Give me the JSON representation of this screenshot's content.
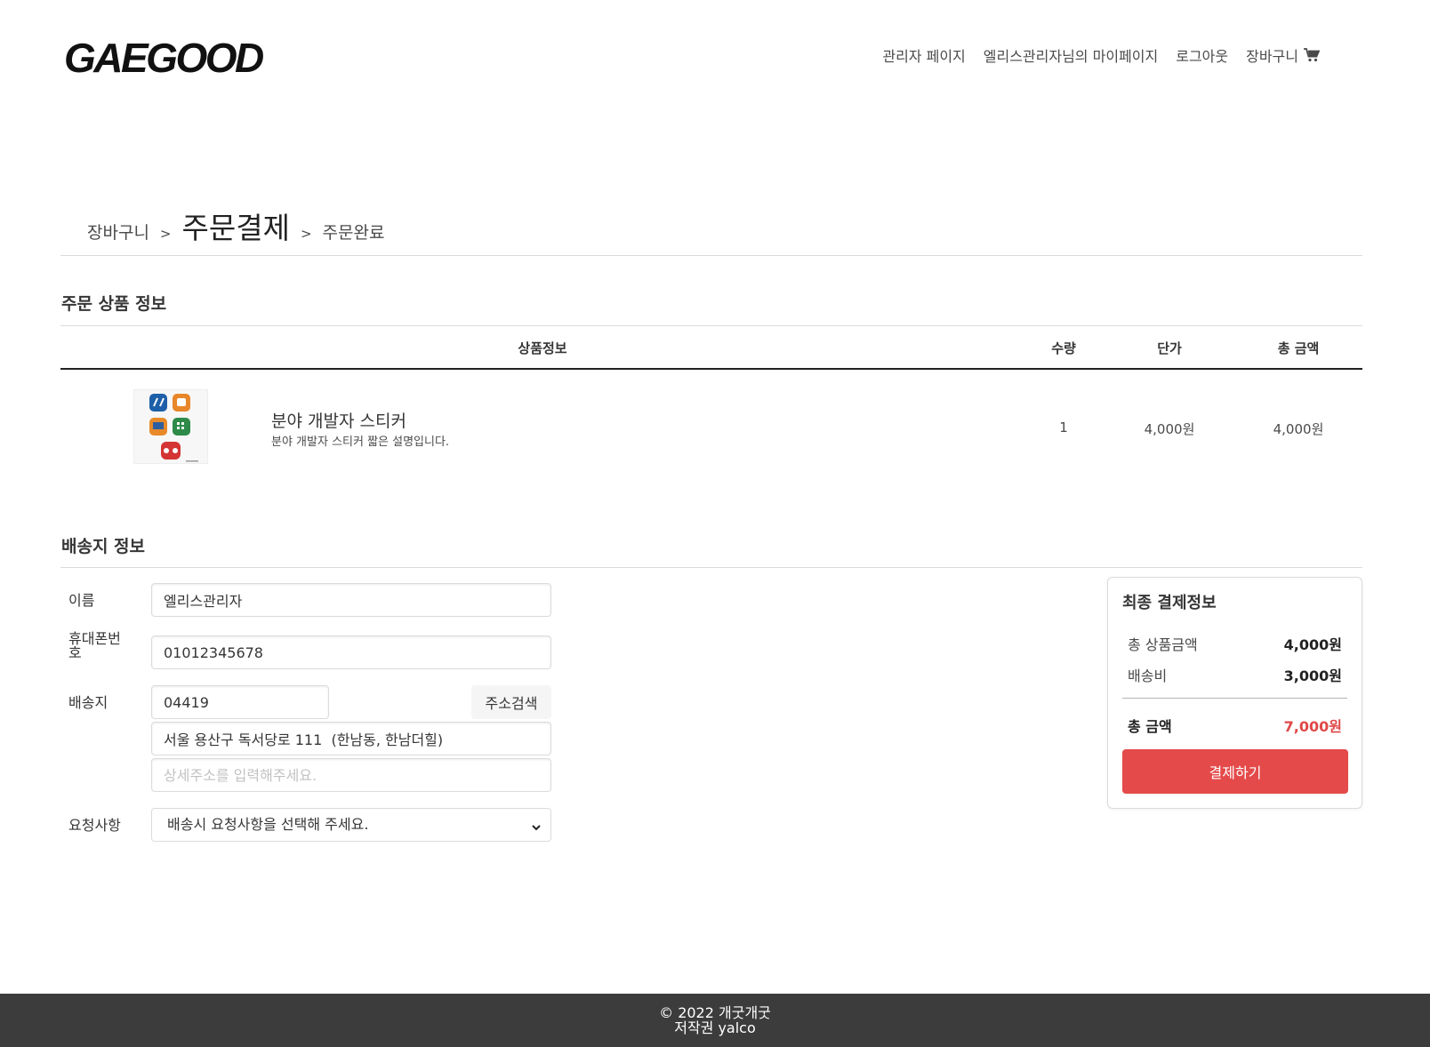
{
  "header": {
    "logo": "GAEGOOD",
    "nav": {
      "admin": "관리자 페이지",
      "mypage": "엘리스관리자님의 마이페이지",
      "logout": "로그아웃",
      "cart": "장바구니"
    }
  },
  "breadcrumb": {
    "cart": "장바구니",
    "sep": ">",
    "checkout": "주문결제",
    "complete": "주문완료"
  },
  "order_section": {
    "title": "주문 상품 정보",
    "columns": {
      "product": "상품정보",
      "qty": "수량",
      "unit_price": "단가",
      "total": "총 금액"
    },
    "item": {
      "name": "분야 개발자 스티커",
      "description": "분야 개발자 스티커 짧은 설명입니다.",
      "qty": "1",
      "unit_price": "4,000원",
      "total": "4,000원"
    }
  },
  "shipping": {
    "title": "배송지 정보",
    "name_label": "이름",
    "name_value": "엘리스관리자",
    "phone_label": "휴대폰번호",
    "phone_value": "01012345678",
    "address_label": "배송지",
    "postcode": "04419",
    "search_button": "주소검색",
    "address1": "서울 용산구 독서당로 111  (한남동, 한남더힐)",
    "address2_placeholder": "상세주소를 입력해주세요.",
    "request_label": "요청사항",
    "request_selected": "배송시 요청사항을 선택해 주세요."
  },
  "summary": {
    "title": "최종 결제정보",
    "subtotal_label": "총 상품금액",
    "subtotal_value": "4,000원",
    "shipping_label": "배송비",
    "shipping_value": "3,000원",
    "total_label": "총 금액",
    "total_value": "7,000원",
    "pay_button": "결제하기"
  },
  "footer": {
    "line1": "© 2022 개굿개굿",
    "line2": "저작권 yalco"
  },
  "colors": {
    "accent": "#e44a4a",
    "total_text": "#e04848",
    "footer_bg": "#3c3c3c"
  }
}
